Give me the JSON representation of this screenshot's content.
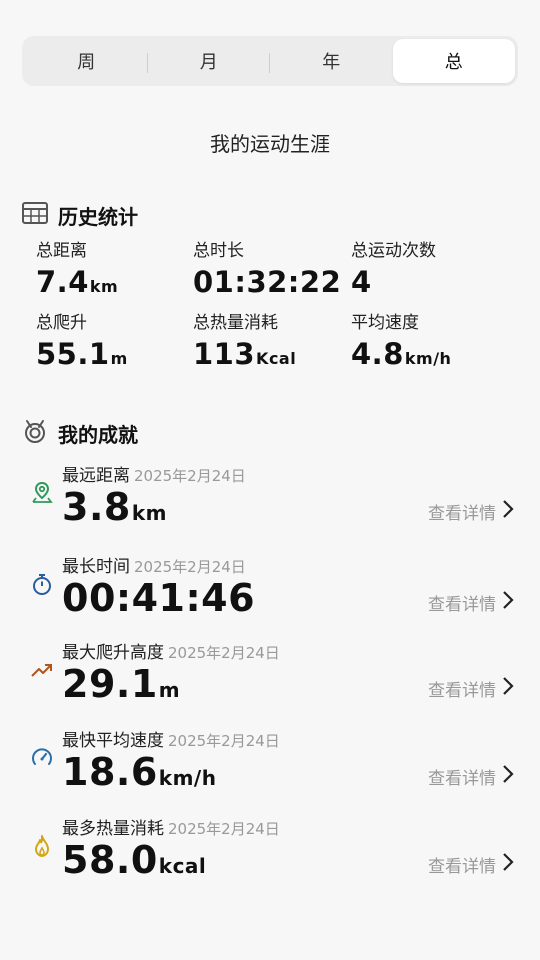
{
  "tabs": [
    "周",
    "月",
    "年",
    "总"
  ],
  "page_title": "我的运动生涯",
  "history": {
    "heading": "历史统计",
    "stats": [
      {
        "label": "总距离",
        "value": "7.4",
        "unit": "km"
      },
      {
        "label": "总时长",
        "value": "01:32:22",
        "unit": ""
      },
      {
        "label": "总运动次数",
        "value": "4",
        "unit": ""
      },
      {
        "label": "总爬升",
        "value": "55.1",
        "unit": "m"
      },
      {
        "label": "总热量消耗",
        "value": "113",
        "unit": "Kcal"
      },
      {
        "label": "平均速度",
        "value": "4.8",
        "unit": "km/h"
      }
    ]
  },
  "achievements": {
    "heading": "我的成就",
    "link_label": "查看详情",
    "items": [
      {
        "title": "最远距离",
        "date": "2025年2月24日",
        "value": "3.8",
        "unit": "km",
        "icon": "map-pin-icon",
        "color": "#2e9a5a"
      },
      {
        "title": "最长时间",
        "date": "2025年2月24日",
        "value": "00:41:46",
        "unit": "",
        "icon": "stopwatch-icon",
        "color": "#2a5d9f"
      },
      {
        "title": "最大爬升高度",
        "date": "2025年2月24日",
        "value": "29.1",
        "unit": "m",
        "icon": "trend-up-icon",
        "color": "#b5541c"
      },
      {
        "title": "最快平均速度",
        "date": "2025年2月24日",
        "value": "18.6",
        "unit": "km/h",
        "icon": "speedometer-icon",
        "color": "#2a6fa8"
      },
      {
        "title": "最多热量消耗",
        "date": "2025年2月24日",
        "value": "58.0",
        "unit": "kcal",
        "icon": "flame-icon",
        "color": "#d4a514"
      }
    ]
  }
}
